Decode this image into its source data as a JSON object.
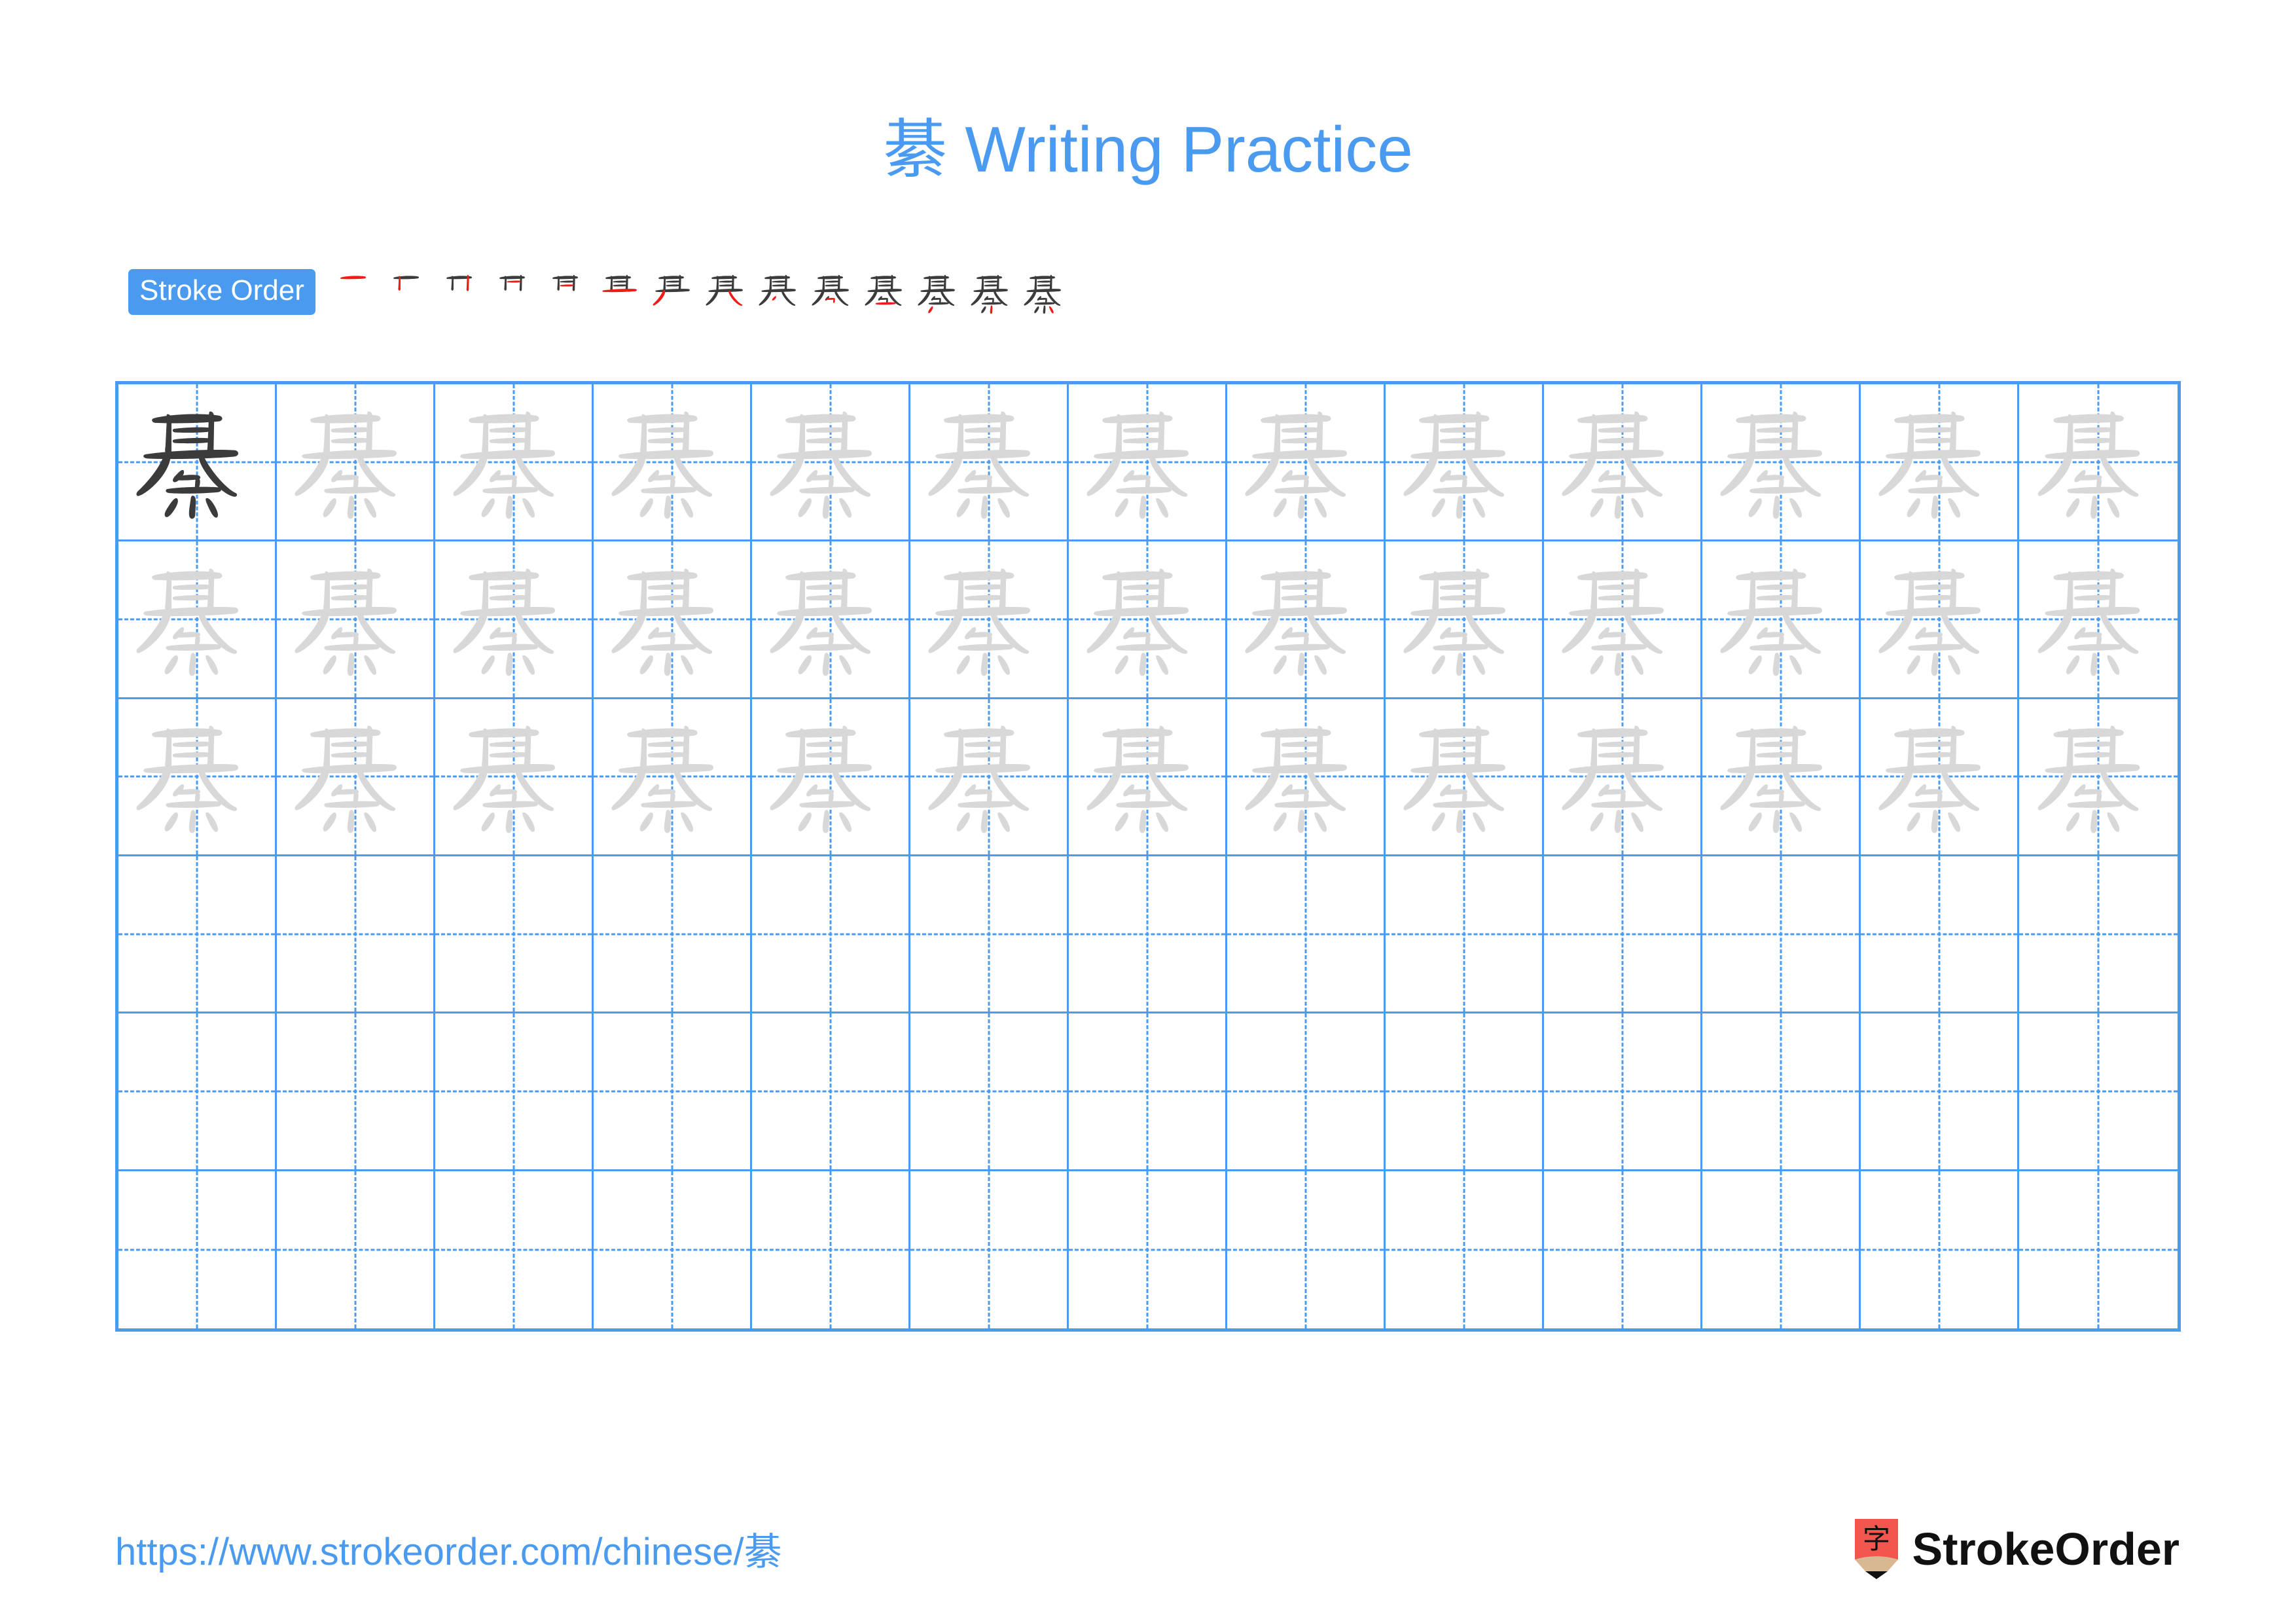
{
  "character": "綦",
  "title": {
    "character": "綦",
    "text": " Writing Practice",
    "full": "綦 Writing Practice",
    "color": "#4a9bf0"
  },
  "stroke_order": {
    "badge_label": "Stroke Order",
    "badge_bg": "#4a9bf0",
    "badge_text_color": "#ffffff",
    "total_strokes": 14,
    "new_stroke_color": "#f01a16",
    "existing_stroke_color": "#3b3b3b",
    "steps": [
      {
        "index": 1,
        "glyph": "一",
        "stroke_name": "heng"
      },
      {
        "index": 2,
        "glyph": "十",
        "stroke_name": "shu"
      },
      {
        "index": 3,
        "glyph": "卄",
        "stroke_name": "shu"
      },
      {
        "index": 4,
        "glyph": "卄",
        "stroke_name": "heng"
      },
      {
        "index": 5,
        "glyph": "廿",
        "stroke_name": "heng"
      },
      {
        "index": 6,
        "glyph": "甘",
        "stroke_name": "heng"
      },
      {
        "index": 7,
        "glyph": "苴",
        "stroke_name": "pie"
      },
      {
        "index": 8,
        "glyph": "其",
        "stroke_name": "na"
      },
      {
        "index": 9,
        "glyph": "其",
        "stroke_name": "pie"
      },
      {
        "index": 10,
        "glyph": "基",
        "stroke_name": "heng-zhe"
      },
      {
        "index": 11,
        "glyph": "基",
        "stroke_name": "heng"
      },
      {
        "index": 12,
        "glyph": "綦",
        "stroke_name": "dian"
      },
      {
        "index": 13,
        "glyph": "綦",
        "stroke_name": "dian"
      },
      {
        "index": 14,
        "glyph": "綦",
        "stroke_name": "dian"
      }
    ]
  },
  "grid": {
    "columns": 13,
    "rows": 6,
    "border_color": "#4a9bf0",
    "guide_color": "#4a9bf0",
    "model_char_color": "#3b3b3b",
    "trace_char_color": "#d8d8d8",
    "filled_rows": 3,
    "empty_rows": 3,
    "model_cell": {
      "row": 1,
      "col": 1
    }
  },
  "footer": {
    "url": "https://www.strokeorder.com/chinese/綦",
    "url_color": "#4a9bf0",
    "logo": {
      "mark_character": "字",
      "mark_body_color": "#f2564f",
      "mark_wood_color": "#d8b893",
      "mark_tip_color": "#111111",
      "wordmark": "StrokeOrder",
      "wordmark_color": "#111111"
    }
  }
}
